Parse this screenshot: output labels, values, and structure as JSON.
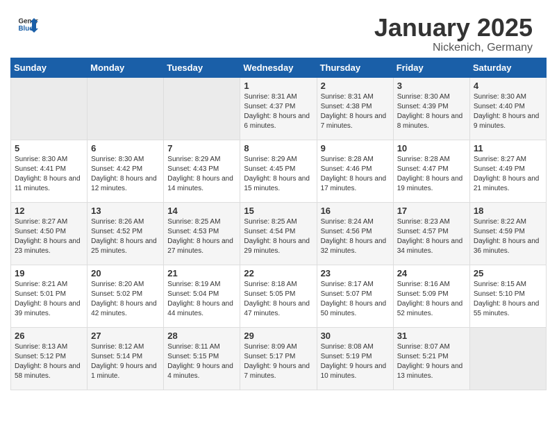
{
  "header": {
    "logo_general": "General",
    "logo_blue": "Blue",
    "month_title": "January 2025",
    "location": "Nickenich, Germany"
  },
  "weekdays": [
    "Sunday",
    "Monday",
    "Tuesday",
    "Wednesday",
    "Thursday",
    "Friday",
    "Saturday"
  ],
  "weeks": [
    [
      {
        "day": "",
        "sunrise": "",
        "sunset": "",
        "daylight": ""
      },
      {
        "day": "",
        "sunrise": "",
        "sunset": "",
        "daylight": ""
      },
      {
        "day": "",
        "sunrise": "",
        "sunset": "",
        "daylight": ""
      },
      {
        "day": "1",
        "sunrise": "Sunrise: 8:31 AM",
        "sunset": "Sunset: 4:37 PM",
        "daylight": "Daylight: 8 hours and 6 minutes."
      },
      {
        "day": "2",
        "sunrise": "Sunrise: 8:31 AM",
        "sunset": "Sunset: 4:38 PM",
        "daylight": "Daylight: 8 hours and 7 minutes."
      },
      {
        "day": "3",
        "sunrise": "Sunrise: 8:30 AM",
        "sunset": "Sunset: 4:39 PM",
        "daylight": "Daylight: 8 hours and 8 minutes."
      },
      {
        "day": "4",
        "sunrise": "Sunrise: 8:30 AM",
        "sunset": "Sunset: 4:40 PM",
        "daylight": "Daylight: 8 hours and 9 minutes."
      }
    ],
    [
      {
        "day": "5",
        "sunrise": "Sunrise: 8:30 AM",
        "sunset": "Sunset: 4:41 PM",
        "daylight": "Daylight: 8 hours and 11 minutes."
      },
      {
        "day": "6",
        "sunrise": "Sunrise: 8:30 AM",
        "sunset": "Sunset: 4:42 PM",
        "daylight": "Daylight: 8 hours and 12 minutes."
      },
      {
        "day": "7",
        "sunrise": "Sunrise: 8:29 AM",
        "sunset": "Sunset: 4:43 PM",
        "daylight": "Daylight: 8 hours and 14 minutes."
      },
      {
        "day": "8",
        "sunrise": "Sunrise: 8:29 AM",
        "sunset": "Sunset: 4:45 PM",
        "daylight": "Daylight: 8 hours and 15 minutes."
      },
      {
        "day": "9",
        "sunrise": "Sunrise: 8:28 AM",
        "sunset": "Sunset: 4:46 PM",
        "daylight": "Daylight: 8 hours and 17 minutes."
      },
      {
        "day": "10",
        "sunrise": "Sunrise: 8:28 AM",
        "sunset": "Sunset: 4:47 PM",
        "daylight": "Daylight: 8 hours and 19 minutes."
      },
      {
        "day": "11",
        "sunrise": "Sunrise: 8:27 AM",
        "sunset": "Sunset: 4:49 PM",
        "daylight": "Daylight: 8 hours and 21 minutes."
      }
    ],
    [
      {
        "day": "12",
        "sunrise": "Sunrise: 8:27 AM",
        "sunset": "Sunset: 4:50 PM",
        "daylight": "Daylight: 8 hours and 23 minutes."
      },
      {
        "day": "13",
        "sunrise": "Sunrise: 8:26 AM",
        "sunset": "Sunset: 4:52 PM",
        "daylight": "Daylight: 8 hours and 25 minutes."
      },
      {
        "day": "14",
        "sunrise": "Sunrise: 8:25 AM",
        "sunset": "Sunset: 4:53 PM",
        "daylight": "Daylight: 8 hours and 27 minutes."
      },
      {
        "day": "15",
        "sunrise": "Sunrise: 8:25 AM",
        "sunset": "Sunset: 4:54 PM",
        "daylight": "Daylight: 8 hours and 29 minutes."
      },
      {
        "day": "16",
        "sunrise": "Sunrise: 8:24 AM",
        "sunset": "Sunset: 4:56 PM",
        "daylight": "Daylight: 8 hours and 32 minutes."
      },
      {
        "day": "17",
        "sunrise": "Sunrise: 8:23 AM",
        "sunset": "Sunset: 4:57 PM",
        "daylight": "Daylight: 8 hours and 34 minutes."
      },
      {
        "day": "18",
        "sunrise": "Sunrise: 8:22 AM",
        "sunset": "Sunset: 4:59 PM",
        "daylight": "Daylight: 8 hours and 36 minutes."
      }
    ],
    [
      {
        "day": "19",
        "sunrise": "Sunrise: 8:21 AM",
        "sunset": "Sunset: 5:01 PM",
        "daylight": "Daylight: 8 hours and 39 minutes."
      },
      {
        "day": "20",
        "sunrise": "Sunrise: 8:20 AM",
        "sunset": "Sunset: 5:02 PM",
        "daylight": "Daylight: 8 hours and 42 minutes."
      },
      {
        "day": "21",
        "sunrise": "Sunrise: 8:19 AM",
        "sunset": "Sunset: 5:04 PM",
        "daylight": "Daylight: 8 hours and 44 minutes."
      },
      {
        "day": "22",
        "sunrise": "Sunrise: 8:18 AM",
        "sunset": "Sunset: 5:05 PM",
        "daylight": "Daylight: 8 hours and 47 minutes."
      },
      {
        "day": "23",
        "sunrise": "Sunrise: 8:17 AM",
        "sunset": "Sunset: 5:07 PM",
        "daylight": "Daylight: 8 hours and 50 minutes."
      },
      {
        "day": "24",
        "sunrise": "Sunrise: 8:16 AM",
        "sunset": "Sunset: 5:09 PM",
        "daylight": "Daylight: 8 hours and 52 minutes."
      },
      {
        "day": "25",
        "sunrise": "Sunrise: 8:15 AM",
        "sunset": "Sunset: 5:10 PM",
        "daylight": "Daylight: 8 hours and 55 minutes."
      }
    ],
    [
      {
        "day": "26",
        "sunrise": "Sunrise: 8:13 AM",
        "sunset": "Sunset: 5:12 PM",
        "daylight": "Daylight: 8 hours and 58 minutes."
      },
      {
        "day": "27",
        "sunrise": "Sunrise: 8:12 AM",
        "sunset": "Sunset: 5:14 PM",
        "daylight": "Daylight: 9 hours and 1 minute."
      },
      {
        "day": "28",
        "sunrise": "Sunrise: 8:11 AM",
        "sunset": "Sunset: 5:15 PM",
        "daylight": "Daylight: 9 hours and 4 minutes."
      },
      {
        "day": "29",
        "sunrise": "Sunrise: 8:09 AM",
        "sunset": "Sunset: 5:17 PM",
        "daylight": "Daylight: 9 hours and 7 minutes."
      },
      {
        "day": "30",
        "sunrise": "Sunrise: 8:08 AM",
        "sunset": "Sunset: 5:19 PM",
        "daylight": "Daylight: 9 hours and 10 minutes."
      },
      {
        "day": "31",
        "sunrise": "Sunrise: 8:07 AM",
        "sunset": "Sunset: 5:21 PM",
        "daylight": "Daylight: 9 hours and 13 minutes."
      },
      {
        "day": "",
        "sunrise": "",
        "sunset": "",
        "daylight": ""
      }
    ]
  ]
}
